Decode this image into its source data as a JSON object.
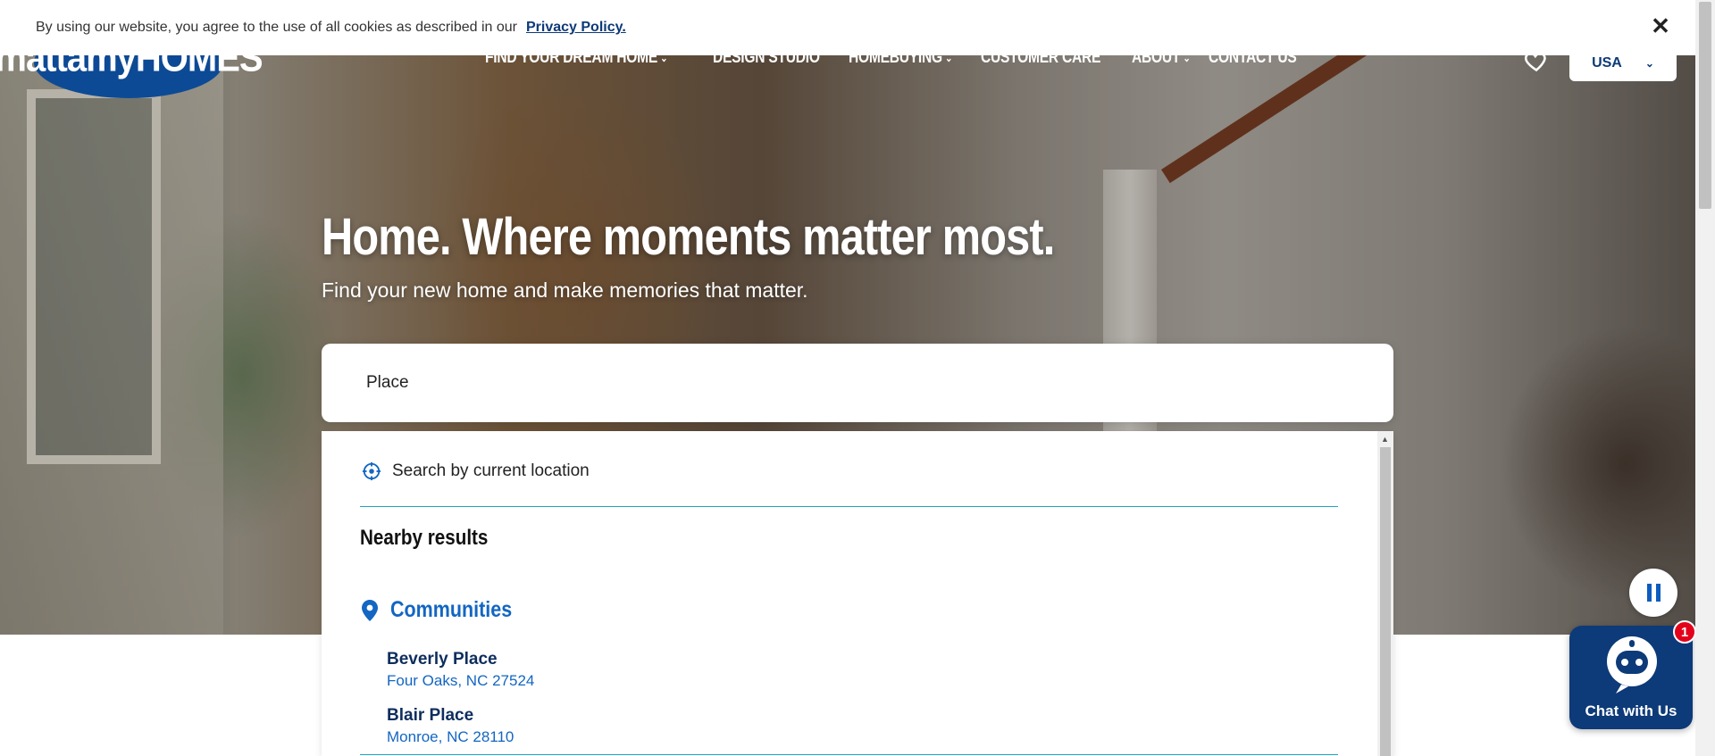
{
  "cookie_bar": {
    "text": "By using our website, you agree to the use of all cookies as described in our",
    "link": "Privacy Policy.",
    "close_icon": "close-icon"
  },
  "brand": {
    "logo_text": "mattamyHOMES",
    "brand_color": "#0d4a96"
  },
  "nav": {
    "items": [
      {
        "label": "FIND YOUR DREAM HOME",
        "has_dropdown": true
      },
      {
        "label": "DESIGN STUDIO",
        "has_dropdown": false
      },
      {
        "label": "HOMEBUYING",
        "has_dropdown": true
      },
      {
        "label": "CUSTOMER CARE",
        "has_dropdown": false
      },
      {
        "label": "ABOUT",
        "has_dropdown": true
      },
      {
        "label": "CONTACT US",
        "has_dropdown": false
      }
    ],
    "favorites_icon": "heart-icon",
    "country": "USA"
  },
  "hero": {
    "headline": "Home. Where moments matter most.",
    "subline": "Find your new home and make memories that matter."
  },
  "search": {
    "value": "Place"
  },
  "dropdown": {
    "current_location": "Search by current location",
    "nearby_heading": "Nearby results",
    "communities_label": "Communities",
    "results": [
      {
        "name": "Beverly Place",
        "location": "Four Oaks, NC 27524"
      },
      {
        "name": "Blair Place",
        "location": "Monroe, NC 28110"
      }
    ],
    "accent_color": "#1366c2"
  },
  "video": {
    "pause_icon": "pause-icon"
  },
  "chat": {
    "label": "Chat with Us",
    "badge_count": "1",
    "icon": "chatbot-icon"
  }
}
